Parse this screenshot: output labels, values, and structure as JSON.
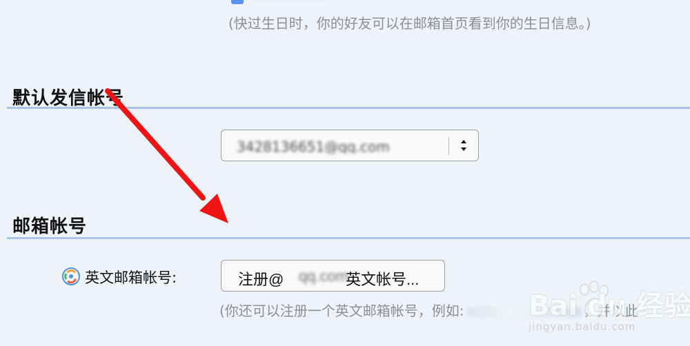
{
  "birthday_hint": "(快过生日时，你的好友可以在邮箱首页看到你的生日信息。)",
  "sections": {
    "default_sender": {
      "title": "默认发信帐号",
      "select_value": "3428136651@qq.com"
    },
    "mailbox_account": {
      "title": "邮箱帐号",
      "english_account_label": "英文邮箱帐号:",
      "register_button_left": "注册@",
      "register_button_blur": "qq.com",
      "register_button_right": "英文帐号...",
      "hint_prefix": "(你还可以注册一个英文邮箱帐号，例如:",
      "hint_suffix": "，并以此"
    }
  },
  "watermark": {
    "brand": "Bai du 经验",
    "url": "jingyan.baidu.com"
  },
  "colors": {
    "background": "#eef3f9",
    "section_rule": "#a9c4e5",
    "arrow": "#ef1414",
    "checkbox_accent": "#5b8ff0"
  }
}
